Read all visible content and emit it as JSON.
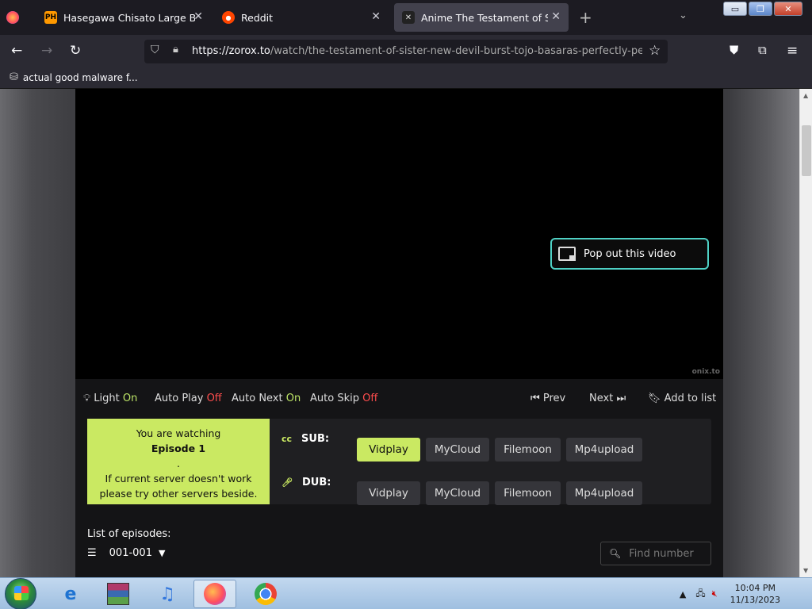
{
  "browser": {
    "tabs": [
      {
        "label": "Hasegawa Chisato Large Boobs",
        "favicon": "PH"
      },
      {
        "label": "Reddit",
        "favicon": "reddit-icon"
      },
      {
        "label": "Anime The Testament of Sister New Devil",
        "favicon": "zoro-icon"
      }
    ],
    "url_domain": "https://zorox.to",
    "url_path": "/watch/the-testament-of-sister-new-devil-burst-tojo-basaras-perfectly-peaceful-vacation",
    "bookmark_label": "actual good malware f..."
  },
  "player": {
    "popout_label": "Pop out this video",
    "watermark": "onix.to",
    "controls": {
      "light_label": "Light",
      "light_value": "On",
      "autoplay_label": "Auto Play",
      "autoplay_value": "Off",
      "autonext_label": "Auto Next",
      "autonext_value": "On",
      "autoskip_label": "Auto Skip",
      "autoskip_value": "Off",
      "prev_label": "Prev",
      "next_label": "Next",
      "add_label": "Add to list"
    },
    "watching": {
      "line1": "You are watching",
      "episode": "Episode 1",
      "dot": ".",
      "hint1": "If current server doesn't work",
      "hint2": "please try other servers beside."
    },
    "sub_label": "SUB:",
    "dub_label": "DUB:",
    "sub_servers": [
      "Vidplay",
      "MyCloud",
      "Filemoon",
      "Mp4upload"
    ],
    "dub_servers": [
      "Vidplay",
      "MyCloud",
      "Filemoon",
      "Mp4upload"
    ],
    "active_sub_server": "Vidplay"
  },
  "episodes": {
    "title": "List of episodes:",
    "range": "001-001",
    "search_placeholder": "Find number"
  },
  "taskbar": {
    "time": "10:04 PM",
    "date": "11/13/2023"
  },
  "colors": {
    "accent": "#cae962",
    "on": "#bde567",
    "off": "#ff4d4d",
    "popout_border": "#4fd1c5"
  }
}
